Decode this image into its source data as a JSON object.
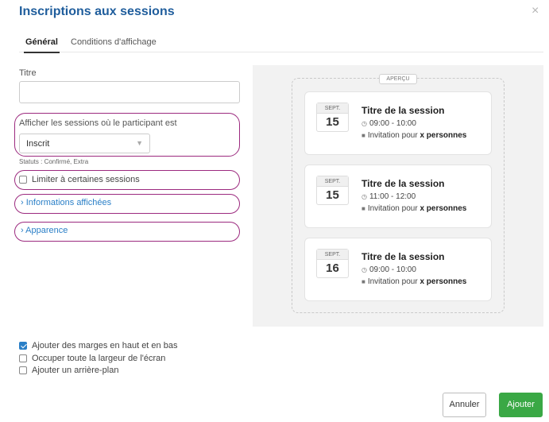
{
  "dialog": {
    "title": "Inscriptions aux sessions",
    "close_glyph": "×"
  },
  "tabs": [
    {
      "label": "Général",
      "active": true
    },
    {
      "label": "Conditions d'affichage",
      "active": false
    }
  ],
  "form": {
    "title_label": "Titre",
    "title_value": "",
    "show_sessions_label": "Afficher les sessions où le participant est",
    "status_select_value": "Inscrit",
    "statuses_hint": "Statuts : Confirmé, Extra",
    "limit_sessions_label": "Limiter à certaines sessions",
    "limit_sessions_checked": false,
    "displayed_info_link": "Informations affichées",
    "appearance_link": "Apparence",
    "chevron_glyph": "›",
    "caret_glyph": "▼"
  },
  "preview": {
    "tag": "APERÇU",
    "cards": [
      {
        "month": "SEPT.",
        "day": "15",
        "title": "Titre de la session",
        "time": "09:00 - 10:00",
        "invite_prefix": "Invitation pour",
        "invite_bold": "x personnes"
      },
      {
        "month": "SEPT.",
        "day": "15",
        "title": "Titre de la session",
        "time": "11:00 - 12:00",
        "invite_prefix": "Invitation pour",
        "invite_bold": "x personnes"
      },
      {
        "month": "SEPT.",
        "day": "16",
        "title": "Titre de la session",
        "time": "09:00 - 10:00",
        "invite_prefix": "Invitation pour",
        "invite_bold": "x personnes"
      }
    ]
  },
  "options": [
    {
      "label": "Ajouter des marges en haut et en bas",
      "checked": true
    },
    {
      "label": "Occuper toute la largeur de l'écran",
      "checked": false
    },
    {
      "label": "Ajouter un arrière-plan",
      "checked": false
    }
  ],
  "buttons": {
    "cancel": "Annuler",
    "add": "Ajouter"
  },
  "colors": {
    "title": "#1f5d9c",
    "highlight": "#9c2a7f",
    "link": "#2a7fc7",
    "add_button": "#3aa845"
  },
  "icons": {
    "clock": "clock-icon",
    "ticket": "ticket-icon",
    "close": "close-icon"
  }
}
